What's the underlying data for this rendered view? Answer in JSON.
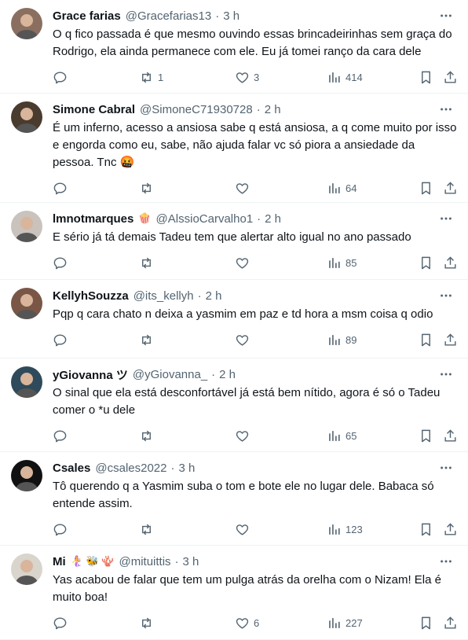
{
  "tweets": [
    {
      "name": "Grace farias",
      "handle": "@Gracefarias13",
      "time": "3 h",
      "text": "O q fico passada é que mesmo ouvindo essas brincadeirinhas sem graça do Rodrigo, ela ainda permanece com ele. Eu já tomei ranço da cara dele",
      "replies": "",
      "retweets": "1",
      "likes": "3",
      "views": "414",
      "avatar_color": "#8a6f60"
    },
    {
      "name": "Simone Cabral",
      "handle": "@SimoneC71930728",
      "time": "2 h",
      "text": "É um inferno,  acesso a ansiosa sabe q está ansiosa, a q come muito por isso e engorda como eu, sabe, não ajuda falar vc só piora a ansiedade da pessoa. Tnc 🤬",
      "replies": "",
      "retweets": "",
      "likes": "",
      "views": "64",
      "avatar_color": "#4a3b2f"
    },
    {
      "name": "lmnotmarques",
      "name_emoji": "🍿",
      "handle": "@AlssioCarvalho1",
      "time": "2 h",
      "text": "E sério já tá demais Tadeu tem que alertar alto igual no ano passado",
      "replies": "",
      "retweets": "",
      "likes": "",
      "views": "85",
      "avatar_color": "#c9c2bd"
    },
    {
      "name": "KellyhSouzza",
      "handle": "@its_kellyh",
      "time": "2 h",
      "text": "Pqp q cara chato n deixa a yasmim em paz e td hora a msm coisa q odio",
      "replies": "",
      "retweets": "",
      "likes": "",
      "views": "89",
      "avatar_color": "#7a5646"
    },
    {
      "name": "yGiovanna ツ",
      "handle": "@yGiovanna_",
      "time": "2 h",
      "text": "O sinal que ela está desconfortável já está bem nítido, agora é só o Tadeu comer o *u dele",
      "replies": "",
      "retweets": "",
      "likes": "",
      "views": "65",
      "avatar_color": "#2f4a5a"
    },
    {
      "name": "Csales",
      "handle": "@csales2022",
      "time": "3 h",
      "text": "Tô querendo q a Yasmim suba o tom e bote ele no lugar dele. Babaca só entende assim.",
      "replies": "",
      "retweets": "",
      "likes": "",
      "views": "123",
      "avatar_color": "#111111"
    },
    {
      "name": "Mi",
      "name_emoji": "🧜‍♀️ 🐝 🪸",
      "handle": "@mituittis",
      "time": "3 h",
      "text": "Yas acabou de falar que tem um pulga atrás da orelha com o Nizam! Ela é muito boa!",
      "replies": "",
      "retweets": "",
      "likes": "6",
      "views": "227",
      "avatar_color": "#d9d4cc"
    }
  ],
  "icons": {
    "more": "more-icon",
    "reply": "reply-icon",
    "retweet": "retweet-icon",
    "like": "like-icon",
    "views": "views-icon",
    "bookmark": "bookmark-icon",
    "share": "share-icon"
  },
  "colors": {
    "text": "#0f1419",
    "muted": "#536471",
    "divider": "#eff3f4"
  }
}
